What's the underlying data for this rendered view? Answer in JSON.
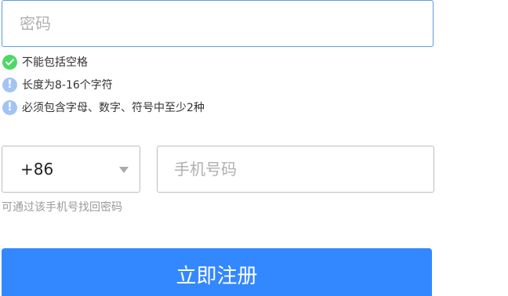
{
  "password": {
    "placeholder": "密码",
    "value": ""
  },
  "rules": [
    {
      "status": "passed",
      "icon": "check-circle-icon",
      "color": "#4cd964",
      "text": "不能包括空格"
    },
    {
      "status": "pending",
      "icon": "info-circle-icon",
      "color": "#a3c4f3",
      "text": "长度为8-16个字符"
    },
    {
      "status": "pending",
      "icon": "info-circle-icon",
      "color": "#a3c4f3",
      "text": "必须包含字母、数字、符号中至少2种"
    }
  ],
  "phone": {
    "country_code": "+86",
    "placeholder": "手机号码",
    "value": "",
    "hint": "可通过该手机号找回密码"
  },
  "submit": {
    "label": "立即注册",
    "color": "#3388ff"
  }
}
